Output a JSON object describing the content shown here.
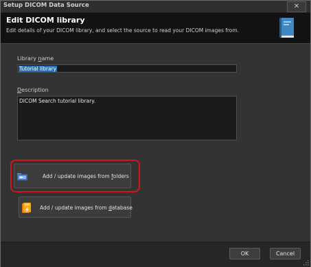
{
  "window": {
    "title": "Setup DICOM Data Source",
    "close_glyph": "✕"
  },
  "header": {
    "title": "Edit DICOM library",
    "description": "Edit details of your DICOM library, and select the source to read your DICOM images from.",
    "icon": "book-icon"
  },
  "library_name": {
    "label_pre": "Library ",
    "label_accel": "n",
    "label_post": "ame",
    "value": "Tutorial library"
  },
  "description_field": {
    "label_accel": "D",
    "label_post": "escription",
    "value": "DICOM Search tutorial library."
  },
  "actions": {
    "folders": {
      "label_pre": "Add / update images from ",
      "label_accel": "f",
      "label_post": "olders",
      "icon": "folder-icon",
      "highlighted": true
    },
    "database": {
      "label_pre": "Add / update images from ",
      "label_accel": "d",
      "label_post": "atabase",
      "icon": "database-icon"
    }
  },
  "footer": {
    "ok_label": "OK",
    "cancel_label": "Cancel"
  },
  "colors": {
    "highlight": "#d6141c",
    "selection": "#2c6fb0",
    "header_bg": "#121212"
  }
}
